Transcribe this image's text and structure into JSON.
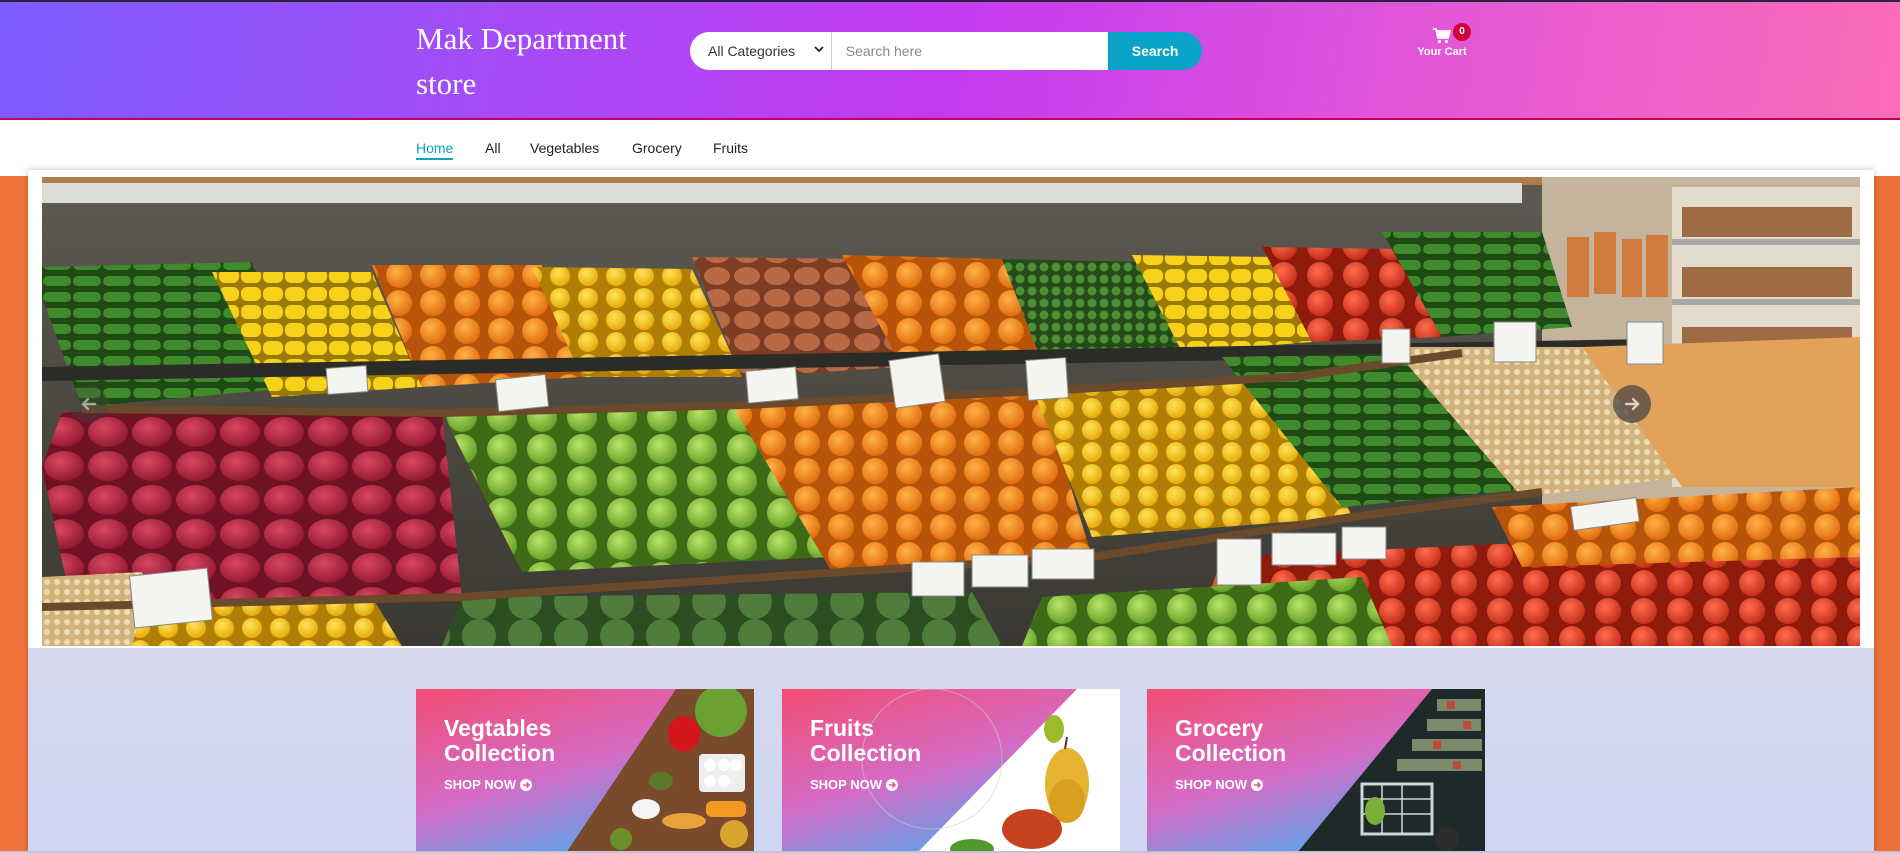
{
  "header": {
    "logo": "Mak Department store",
    "category_select": "All Categories",
    "search_placeholder": "Search here",
    "search_button": "Search",
    "cart_count": "0",
    "cart_label": "Your Cart"
  },
  "nav": {
    "items": [
      {
        "label": "Home",
        "active": true
      },
      {
        "label": "All"
      },
      {
        "label": "Vegetables"
      },
      {
        "label": "Grocery"
      },
      {
        "label": "Fruits"
      }
    ]
  },
  "slider": {
    "image": "produce-aisle-photo",
    "prev_icon": "arrow-left-icon",
    "next_icon": "arrow-right-icon"
  },
  "banners": [
    {
      "title_line1": "Vegtables",
      "title_line2": "Collection",
      "cta": "SHOP NOW"
    },
    {
      "title_line1": "Fruits",
      "title_line2": "Collection",
      "cta": "SHOP NOW"
    },
    {
      "title_line1": "Grocery",
      "title_line2": "Collection",
      "cta": "SHOP NOW"
    }
  ],
  "colors": {
    "accent": "#0aa3c8",
    "badge": "#d0003a",
    "header_gradient_start": "#7c5cff",
    "header_gradient_end": "#fb6cb8"
  }
}
